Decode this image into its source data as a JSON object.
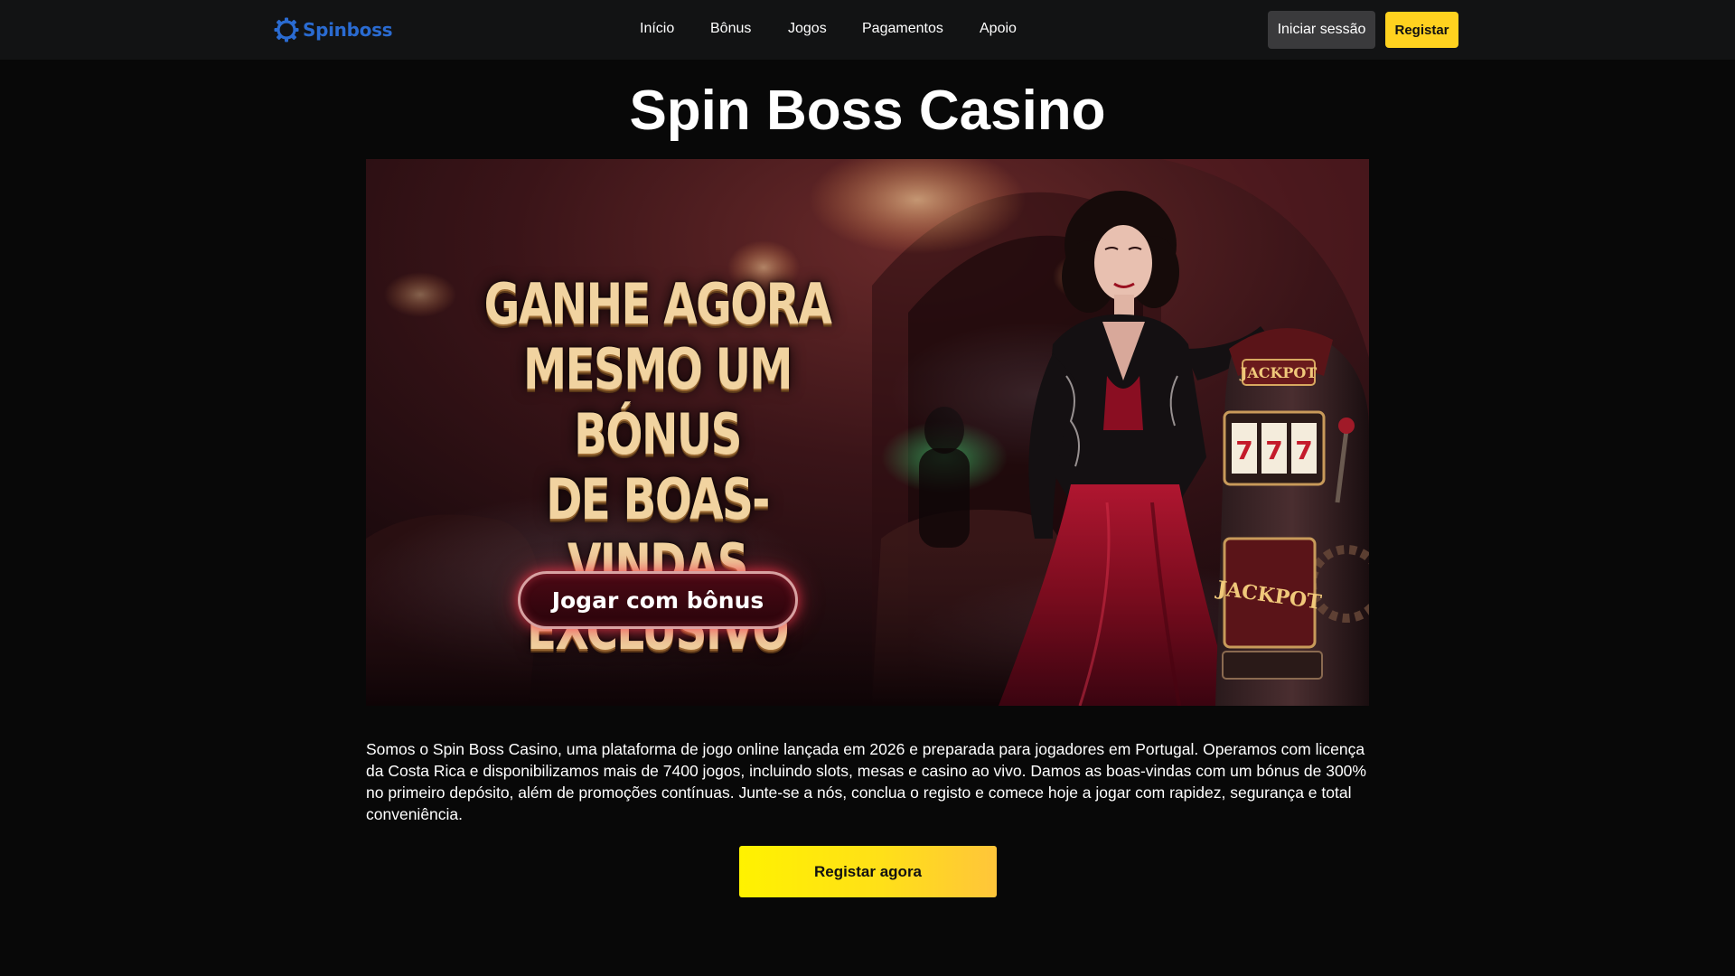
{
  "header": {
    "logo_text": "Spinboss",
    "nav": [
      {
        "label": "Início"
      },
      {
        "label": "Bônus"
      },
      {
        "label": "Jogos"
      },
      {
        "label": "Pagamentos"
      },
      {
        "label": "Apoio"
      }
    ],
    "login_label": "Iniciar sessão",
    "register_label": "Registar"
  },
  "main": {
    "title": "Spin Boss Casino",
    "banner": {
      "headline_lines": [
        "Ganhe agora",
        "mesmo um bónus",
        "de boas-vindas",
        "exclusivo"
      ],
      "cta_label": "Jogar com bônus",
      "slot_sign_top": "JACKPOT",
      "slot_sign_bottom": "JACKPOT",
      "reels": [
        "7",
        "7",
        "7"
      ]
    },
    "description": "Somos o Spin Boss Casino, uma plataforma de jogo online lançada em 2026 e preparada para jogadores em Portugal. Operamos com licença da Costa Rica e disponibilizamos mais de 7400 jogos, incluindo slots, mesas e casino ao vivo. Damos as boas-vindas com um bónus de 300% no primeiro depósito, além de promoções contínuas. Junte-se a nós, conclua o registo e comece hoje a jogar com rapidez, segurança e total conveniência.",
    "register_now_label": "Registar agora"
  },
  "colors": {
    "background": "#080808",
    "header": "#121314",
    "brand_blue": "#2a6bd1",
    "accent_yellow": "#ffd21f",
    "banner_red": "#8a1020"
  },
  "icons": [
    "spinboss-logo-icon"
  ]
}
